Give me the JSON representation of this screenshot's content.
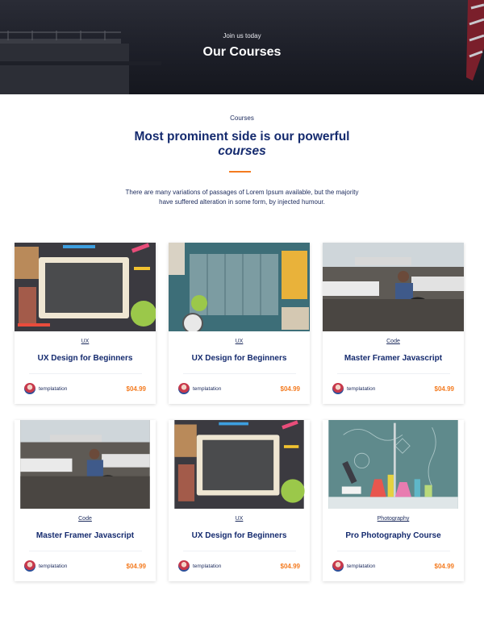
{
  "hero": {
    "subtitle": "Join us today",
    "title": "Our Courses"
  },
  "section": {
    "label": "Courses",
    "heading_line1": "Most prominent side is our powerful",
    "heading_line2": "courses",
    "intro": "There are many variations of passages of Lorem Ipsum available, but the majority have suffered alteration in some form, by injected humour."
  },
  "colors": {
    "accent": "#f47b20",
    "navy": "#142a6e"
  },
  "courses": [
    {
      "image": "chalkboard-tablet",
      "category": "UX",
      "title": "UX Design for Beginners",
      "author": "templatation",
      "price": "$04.99"
    },
    {
      "image": "wooden-board-supplies",
      "category": "UX",
      "title": "UX Design for Beginners",
      "author": "templatation",
      "price": "$04.99"
    },
    {
      "image": "classroom",
      "category": "Code",
      "title": "Master Framer Javascript",
      "author": "templatation",
      "price": "$04.99"
    },
    {
      "image": "classroom",
      "category": "Code",
      "title": "Master Framer Javascript",
      "author": "templatation",
      "price": "$04.99"
    },
    {
      "image": "chalkboard-tablet",
      "category": "UX",
      "title": "UX Design for Beginners",
      "author": "templatation",
      "price": "$04.99"
    },
    {
      "image": "science-lab",
      "category": "Photography",
      "title": "Pro Photography Course",
      "author": "templatation",
      "price": "$04.99"
    }
  ]
}
